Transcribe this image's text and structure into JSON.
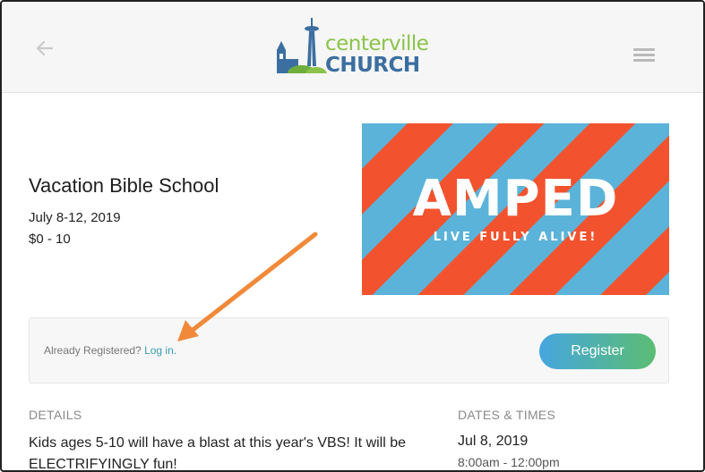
{
  "header": {
    "back_icon": "arrow-left-icon",
    "menu_icon": "hamburger-menu-icon",
    "logo": {
      "word1": "centerville",
      "word2": "CHURCH"
    }
  },
  "event": {
    "title": "Vacation Bible School",
    "date": "July 8-12, 2019",
    "price": "$0 - 10",
    "banner": {
      "title": "AMPED",
      "subtitle": "LIVE FULLY ALIVE!"
    }
  },
  "registration": {
    "already_text": "Already Registered?",
    "login_link": "Log in",
    "login_suffix": ".",
    "register_label": "Register"
  },
  "details": {
    "label": "DETAILS",
    "text": "Kids ages 5-10 will have a blast at this year's VBS! It will be ELECTRIFYINGLY fun!"
  },
  "dates_times": {
    "label": "DATES & TIMES",
    "date": "Jul 8, 2019",
    "time": "8:00am - 12:00pm"
  },
  "colors": {
    "accent_link": "#3a9db0",
    "button_gradient_start": "#46a6df",
    "button_gradient_end": "#5bbd72",
    "banner_stripe_blue": "#5bb3d9",
    "banner_stripe_red": "#f2532e",
    "annotation_arrow": "#f08a3a"
  }
}
